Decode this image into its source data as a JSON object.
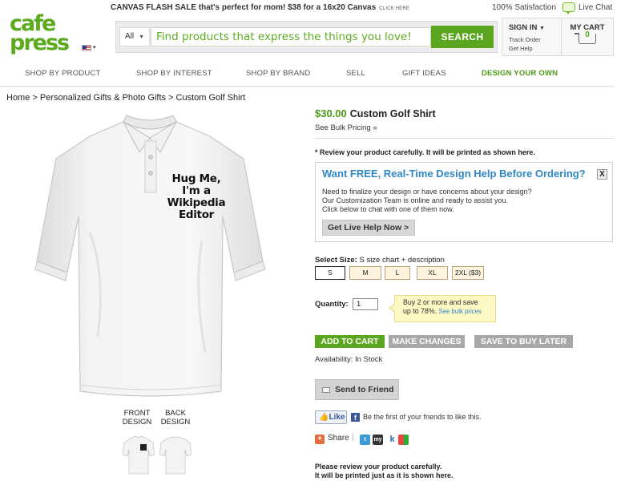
{
  "topbar": {
    "promo": "CANVAS FLASH SALE that's perfect for mom! $38 for a 16x20 Canvas",
    "promo_link": "CLICK HERE",
    "satisfaction": "100% Satisfaction",
    "live_chat": "Live Chat"
  },
  "logo": {
    "line1": "cafe",
    "line2": "press"
  },
  "search": {
    "category": "All",
    "placeholder": "Find products that express the things you love!",
    "button": "SEARCH"
  },
  "account": {
    "sign_in": "SIGN IN",
    "track_order": "Track Order",
    "get_help": "Get Help"
  },
  "cart": {
    "label": "MY CART",
    "count": "0"
  },
  "nav": {
    "items": [
      "SHOP BY PRODUCT",
      "SHOP BY INTEREST",
      "SHOP BY BRAND",
      "SELL",
      "GIFT IDEAS",
      "DESIGN YOUR OWN"
    ]
  },
  "breadcrumb": "Home > Personalized Gifts & Photo Gifts > Custom Golf Shirt",
  "product": {
    "design_text": [
      "Hug Me,",
      "I'm a",
      "Wikipedia",
      "Editor"
    ],
    "front_design": [
      "FRONT",
      "DESIGN"
    ],
    "back_design": [
      "BACK",
      "DESIGN"
    ],
    "price": "$30.00",
    "title": "Custom Golf Shirt",
    "bulk_pricing": "See Bulk Pricing »",
    "review_notice": "* Review your product carefully. It will be printed as shown here."
  },
  "help_box": {
    "title": "Want FREE, Real-Time Design Help Before Ordering?",
    "close": "X",
    "line1": "Need to finalize your design or have concerns about your design?",
    "line2": "Our Customization Team is online and ready to assist you.",
    "line3": "Click below to chat with one of them now.",
    "button": "Get Live Help Now >"
  },
  "size": {
    "label": "Select Size:",
    "selected": "S",
    "extra": "size chart + description",
    "options": [
      "S",
      "M",
      "L",
      "XL",
      "2XL ($3)"
    ]
  },
  "quantity": {
    "label": "Quantity:",
    "value": "1",
    "tip_line1": "Buy 2 or more and save",
    "tip_line2": "up to 78%.",
    "tip_link": "See bulk prices"
  },
  "actions": {
    "add_to_cart": "ADD TO CART",
    "make_changes": "MAKE CHANGES",
    "save_later": "SAVE TO BUY LATER",
    "availability": "Availability: In Stock",
    "send_friend": "Send to Friend"
  },
  "social": {
    "like": "Like",
    "fb_text": "Be the first of your friends to like this.",
    "share": "Share"
  },
  "review_footer": {
    "line1": "Please review your product carefully.",
    "line2": "It will be printed just as it is shown here."
  },
  "colors": {
    "brand_green": "#5aa61f",
    "link_blue": "#2f87c3",
    "button_gray": "#a8a8a8",
    "tip_yellow": "#fdf8c4"
  }
}
